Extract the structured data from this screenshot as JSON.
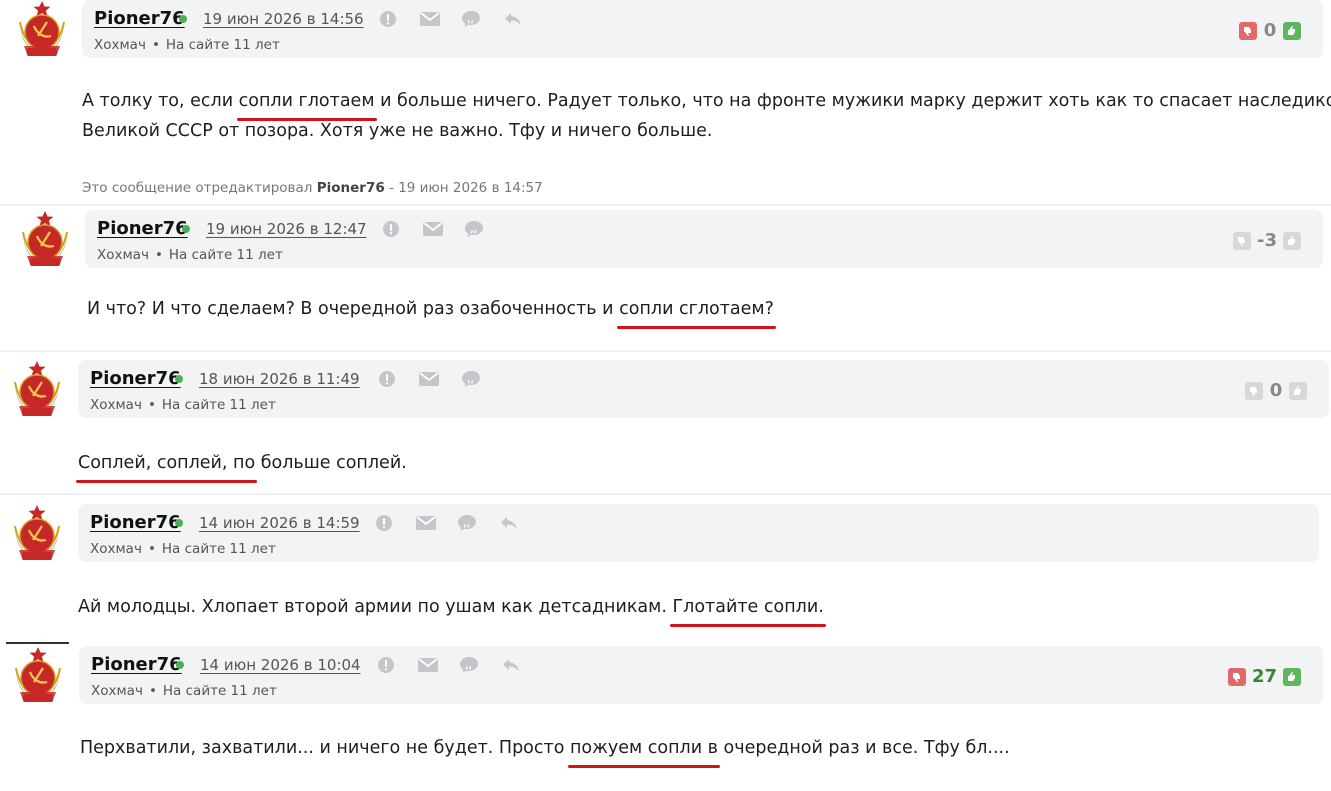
{
  "comments": [
    {
      "username": "Pioner76",
      "date": "19 июн 2026 в 14:56",
      "location": "Хохмач",
      "member": "На сайте 11 лет",
      "rating": "0",
      "rating_color": "#888888",
      "text_lines": [
        [
          "А толку то, если ",
          {
            "mark": "сопли глотаем"
          },
          " и больше ничего. Радует только, что на фронте мужики марку держит хоть как то спасает наследиков"
        ],
        [
          "Великой СССР от позора. Хотя уже не важно. Тфу и ничего больше."
        ]
      ],
      "edited": {
        "prefix": "Это сообщение отредактировал",
        "author": "Pioner76",
        "suffix": "- 19 июн 2026 в 14:57"
      },
      "has_reply": true,
      "icons": [
        "alert-icon",
        "mail-icon",
        "quote-icon",
        "reply-icon"
      ]
    },
    {
      "username": "Pioner76",
      "date": "19 июн 2026 в 12:47",
      "location": "Хохмач",
      "member": "На сайте 11 лет",
      "rating": "-3",
      "rating_color": "#888888",
      "text_lines": [
        [
          "И что? И что сделаем? В очередной раз озабоченность и ",
          {
            "mark": "сопли сглотаем?"
          }
        ]
      ],
      "has_reply": false,
      "icons": [
        "alert-icon",
        "mail-icon",
        "quote-icon"
      ]
    },
    {
      "username": "Pioner76",
      "date": "18 июн 2026 в 11:49",
      "location": "Хохмач",
      "member": "На сайте 11 лет",
      "rating": "0",
      "rating_color": "#888888",
      "text_lines": [
        [
          {
            "mark": "Соплей, соплей, по"
          },
          " больше соплей."
        ]
      ],
      "has_reply": false,
      "icons": [
        "alert-icon",
        "mail-icon",
        "quote-icon"
      ]
    },
    {
      "username": "Pioner76",
      "date": "14 июн 2026 в 14:59",
      "location": "Хохмач",
      "member": "На сайте 11 лет",
      "rating": "",
      "text_lines": [
        [
          "Ай молодцы. Хлопает второй армии по ушам как детсадникам. ",
          {
            "mark": "Глотайте сопли."
          }
        ]
      ],
      "has_reply": true,
      "icons": [
        "alert-icon",
        "mail-icon",
        "quote-icon",
        "reply-icon"
      ]
    },
    {
      "username": "Pioner76",
      "date": "14 июн 2026 в 10:04",
      "location": "Хохмач",
      "member": "На сайте 11 лет",
      "rating": "27",
      "rating_color": "#2e8b2e",
      "text_lines": [
        [
          "Перхватили, захватили... и ничего не будет. Просто ",
          {
            "mark": "пожуем сопли в"
          },
          " очередной раз и все. Тфу бл...."
        ]
      ],
      "has_reply": true,
      "icons": [
        "alert-icon",
        "mail-icon",
        "quote-icon",
        "reply-icon"
      ]
    }
  ],
  "colors": {
    "accent_red": "#d0141a",
    "online": "#4caf50",
    "header_bg": "#f2f3f5",
    "thumb_down_active": "#e06a6a",
    "thumb_up_active": "#5cb85c",
    "thumb_inactive": "#d8d8d8"
  }
}
